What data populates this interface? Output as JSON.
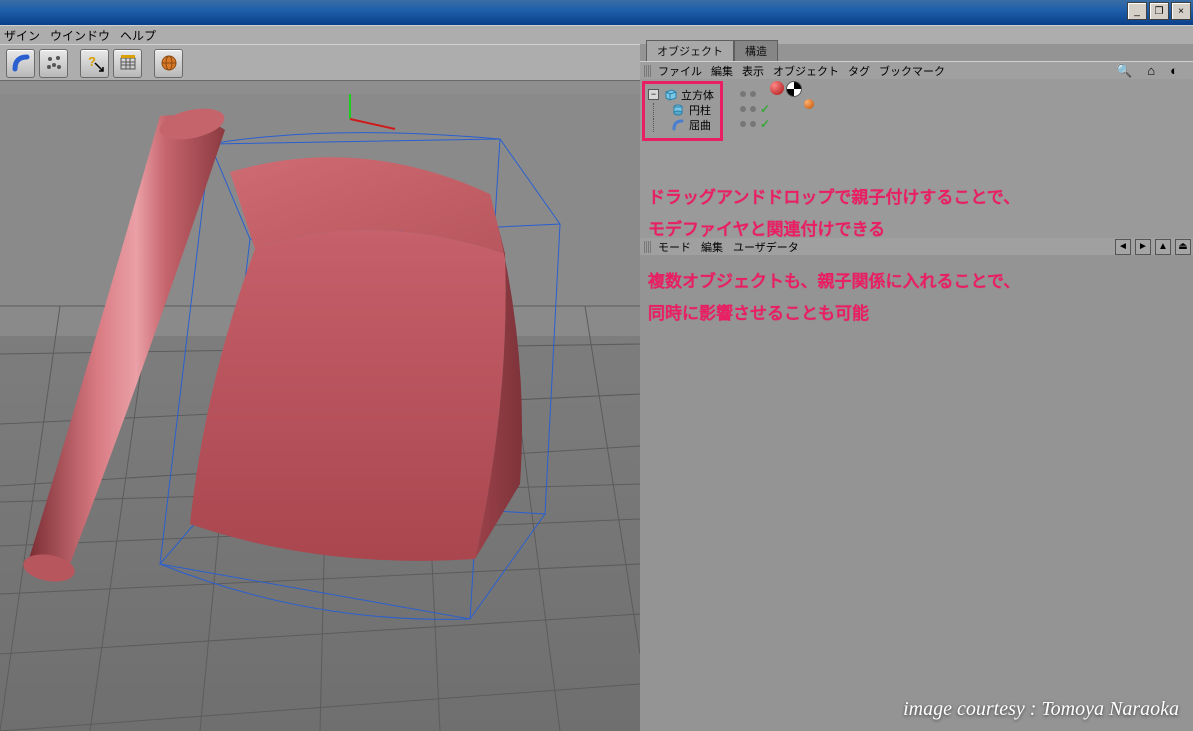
{
  "menubar": {
    "design": "ザイン",
    "window": "ウインドウ",
    "help": "ヘルプ"
  },
  "panel": {
    "tabs": {
      "objects": "オブジェクト",
      "structure": "構造"
    },
    "menu": {
      "file": "ファイル",
      "edit": "編集",
      "view": "表示",
      "objects": "オブジェクト",
      "tags": "タグ",
      "bookmarks": "ブックマーク"
    }
  },
  "tree": {
    "items": [
      {
        "name": "立方体"
      },
      {
        "name": "円柱"
      },
      {
        "name": "屈曲"
      }
    ]
  },
  "annotations": {
    "line1": "ドラッグアンドドロップで親子付けすることで、",
    "line2": "モデファイヤと関連付けできる",
    "line3": "複数オブジェクトも、親子関係に入れることで、",
    "line4": "同時に影響させることも可能"
  },
  "attr_menu": {
    "mode": "モード",
    "edit": "編集",
    "userdata": "ユーザデータ"
  },
  "credit": "image courtesy : Tomoya Naraoka"
}
